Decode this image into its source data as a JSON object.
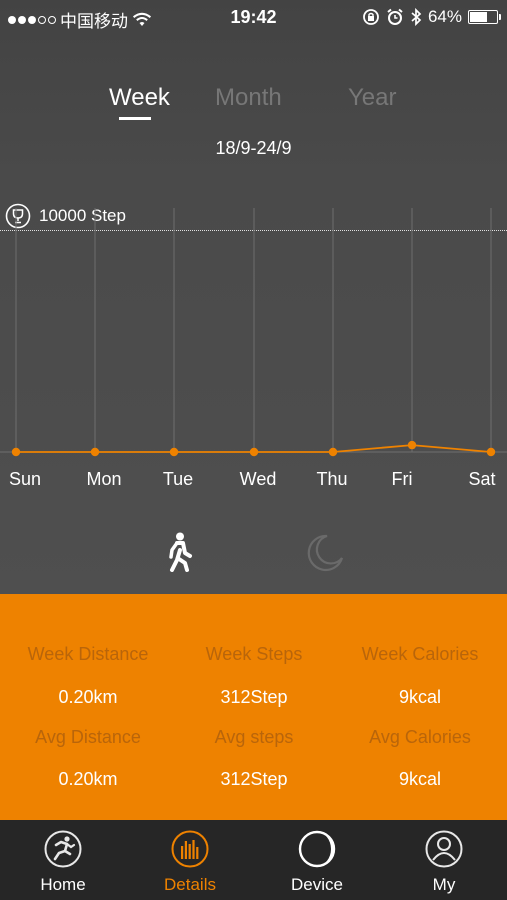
{
  "status_bar": {
    "carrier": "中国移动",
    "time": "19:42",
    "battery": "64%",
    "battery_level": 0.64,
    "signal_bars": 3,
    "signal_total": 5
  },
  "tabs": [
    {
      "label": "Week",
      "active": true
    },
    {
      "label": "Month",
      "active": false
    },
    {
      "label": "Year",
      "active": false
    }
  ],
  "date_range": "18/9-24/9",
  "goal": {
    "label": "10000 Step",
    "icon": "trophy-icon"
  },
  "chart_data": {
    "type": "line",
    "categories": [
      "Sun",
      "Mon",
      "Tue",
      "Wed",
      "Thu",
      "Fri",
      "Sat"
    ],
    "series": [
      {
        "values": [
          0,
          0,
          0,
          0,
          0,
          312,
          0
        ]
      }
    ],
    "goal_value": 10000,
    "ylim": [
      0,
      10000
    ],
    "color": "#ee8200"
  },
  "modes": [
    {
      "icon": "walking-icon",
      "active": true
    },
    {
      "icon": "moon-icon",
      "active": false
    }
  ],
  "stats": {
    "week_distance_label": "Week Distance",
    "week_steps_label": "Week Steps",
    "week_calories_label": "Week Calories",
    "week_distance": "0.20km",
    "week_steps": "312Step",
    "week_calories": "9kcal",
    "avg_distance_label": "Avg Distance",
    "avg_steps_label": "Avg steps",
    "avg_calories_label": "Avg Calories",
    "avg_distance": "0.20km",
    "avg_steps": "312Step",
    "avg_calories": "9kcal"
  },
  "nav": [
    {
      "label": "Home",
      "icon": "running-icon",
      "active": false
    },
    {
      "label": "Details",
      "icon": "bar-chart-icon",
      "active": true
    },
    {
      "label": "Device",
      "icon": "device-icon",
      "active": false
    },
    {
      "label": "My",
      "icon": "user-icon",
      "active": false
    }
  ],
  "colors": {
    "accent": "#ee8200",
    "background": "#4a4a4a",
    "nav_background": "#262626"
  }
}
